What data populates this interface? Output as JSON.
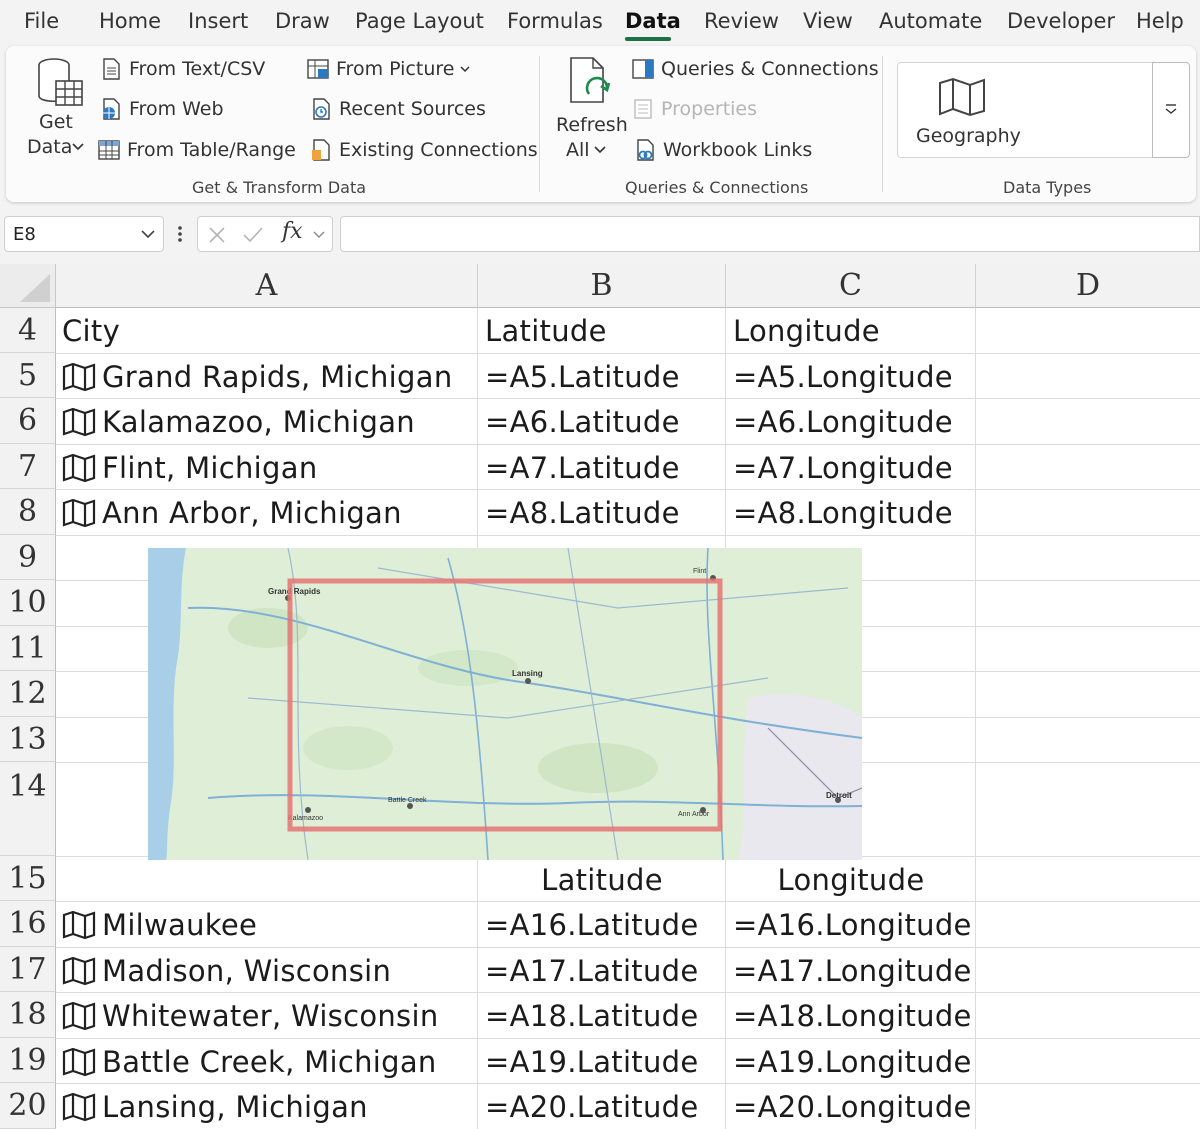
{
  "menu": {
    "items": [
      "File",
      "Home",
      "Insert",
      "Draw",
      "Page Layout",
      "Formulas",
      "Data",
      "Review",
      "View",
      "Automate",
      "Developer",
      "Help"
    ],
    "active": "Data"
  },
  "ribbon": {
    "get_transform": {
      "get_data_line1": "Get",
      "get_data_line2": "Data",
      "from_text_csv": "From Text/CSV",
      "from_web": "From Web",
      "from_table_range": "From Table/Range",
      "from_picture": "From Picture",
      "recent_sources": "Recent Sources",
      "existing_connections": "Existing Connections",
      "label": "Get & Transform Data"
    },
    "queries": {
      "refresh_line1": "Refresh",
      "refresh_line2": "All",
      "queries_connections": "Queries & Connections",
      "properties": "Properties",
      "workbook_links": "Workbook Links",
      "label": "Queries & Connections"
    },
    "data_types": {
      "geography": "Geography",
      "label": "Data Types"
    }
  },
  "formula_bar": {
    "name_box": "E8",
    "fx": "fx",
    "formula": ""
  },
  "sheet": {
    "columns": [
      "A",
      "B",
      "C",
      "D"
    ],
    "rows": [
      "4",
      "5",
      "6",
      "7",
      "8",
      "9",
      "10",
      "11",
      "12",
      "13",
      "14",
      "15",
      "16",
      "17",
      "18",
      "19",
      "20"
    ],
    "header_row": {
      "a": "City",
      "b": "Latitude",
      "c": "Longitude"
    },
    "table1": [
      {
        "city": "Grand Rapids, Michigan",
        "lat": "=A5.Latitude",
        "lon": "=A5.Longitude"
      },
      {
        "city": "Kalamazoo, Michigan",
        "lat": "=A6.Latitude",
        "lon": "=A6.Longitude"
      },
      {
        "city": "Flint, Michigan",
        "lat": "=A7.Latitude",
        "lon": "=A7.Longitude"
      },
      {
        "city": "Ann Arbor, Michigan",
        "lat": "=A8.Latitude",
        "lon": "=A8.Longitude"
      }
    ],
    "row15": {
      "b": "Latitude",
      "c": "Longitude"
    },
    "table2": [
      {
        "city": "Milwaukee",
        "lat": "=A16.Latitude",
        "lon": "=A16.Longitude"
      },
      {
        "city": "Madison, Wisconsin",
        "lat": "=A17.Latitude",
        "lon": "=A17.Longitude"
      },
      {
        "city": "Whitewater, Wisconsin",
        "lat": "=A18.Latitude",
        "lon": "=A18.Longitude"
      },
      {
        "city": "Battle Creek, Michigan",
        "lat": "=A19.Latitude",
        "lon": "=A19.Longitude"
      },
      {
        "city": "Lansing, Michigan",
        "lat": "=A20.Latitude",
        "lon": "=A20.Longitude"
      }
    ]
  },
  "map": {
    "labels": [
      "Grand Rapids",
      "Lansing",
      "Detroit",
      "Ann Arbor",
      "Kalamazoo",
      "Battle Creek",
      "Flint"
    ]
  },
  "colors": {
    "accent": "#1e7145",
    "selection_rect": "#e57373",
    "map_land": "#dfeed6",
    "map_water": "#a9cfe8"
  }
}
